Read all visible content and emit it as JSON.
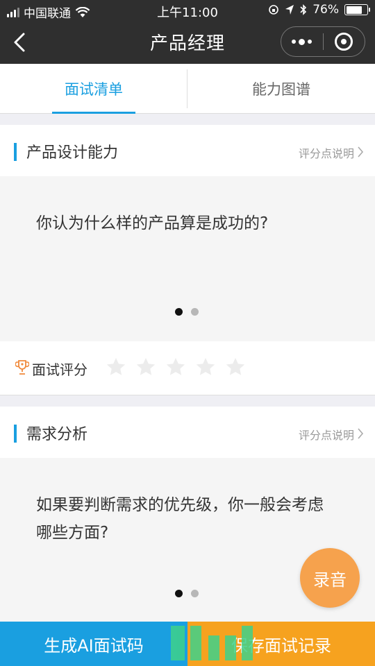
{
  "status_bar": {
    "carrier": "中国联通",
    "time": "上午11:00",
    "battery": "76%",
    "battery_level": 0.76,
    "icons": [
      "signal-icon",
      "wifi-icon",
      "screen-lock-icon",
      "location-icon",
      "bluetooth-icon",
      "battery-icon"
    ]
  },
  "navbar": {
    "title": "产品经理",
    "back_icon": "chevron-left-icon",
    "menu_icon": "more-dots-icon",
    "close_icon": "target-circle-icon"
  },
  "tabs": [
    {
      "label": "面试清单",
      "active": true
    },
    {
      "label": "能力图谱",
      "active": false
    }
  ],
  "cards": [
    {
      "section_title": "产品设计能力",
      "link_label": "评分点说明",
      "question": "你认为什么样的产品算是成功的?",
      "page_total": 2,
      "page_index": 1,
      "rating_label": "面试评分",
      "stars_total": 5,
      "stars_selected": 0
    },
    {
      "section_title": "需求分析",
      "link_label": "评分点说明",
      "question": "如果要判断需求的优先级，你一般会考虑哪些方面?",
      "page_total": 2,
      "page_index": 1
    }
  ],
  "record_button": "录音",
  "bottom_bar": {
    "left_label": "生成AI面试码",
    "right_label": "保存面试记录"
  },
  "colors": {
    "accent_blue": "#1a9fe0",
    "accent_orange": "#f6a21f",
    "record_orange": "#f6a24d",
    "nav_bg": "#2f2f2f"
  }
}
